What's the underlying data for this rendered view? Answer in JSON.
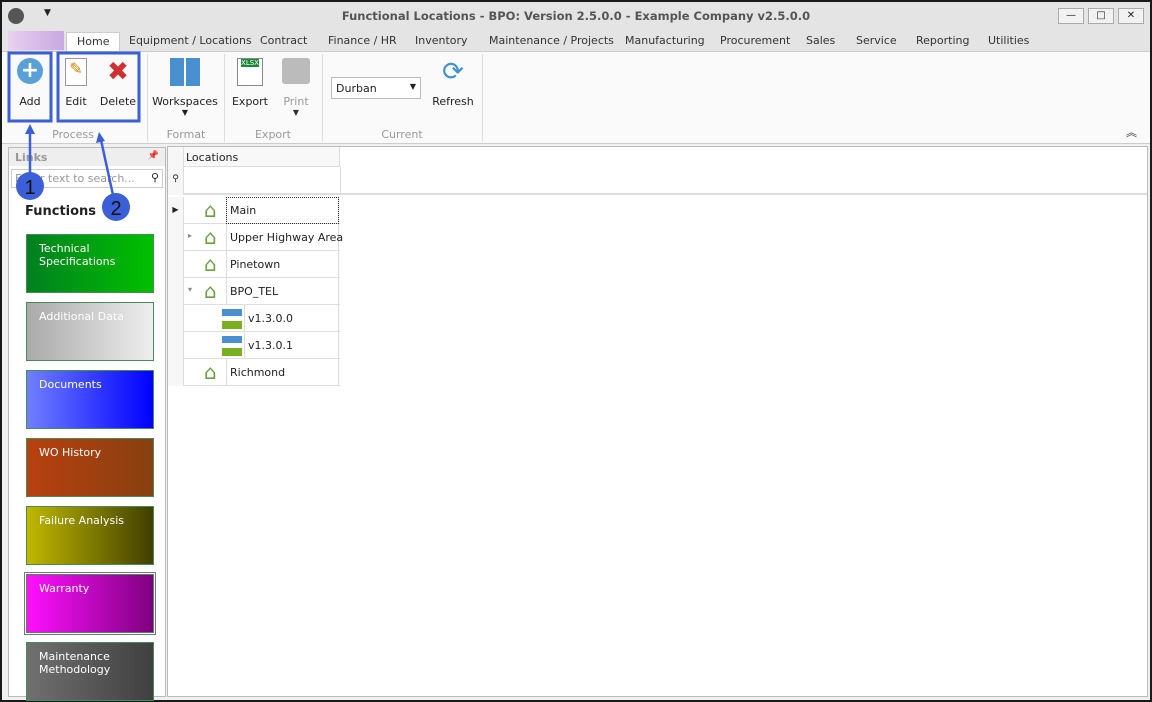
{
  "window": {
    "title": "Functional Locations - BPO: Version 2.5.0.0 - Example Company v2.5.0.0"
  },
  "tabs": [
    "Home",
    "Equipment / Locations",
    "Contract",
    "Finance / HR",
    "Inventory",
    "Maintenance / Projects",
    "Manufacturing",
    "Procurement",
    "Sales",
    "Service",
    "Reporting",
    "Utilities"
  ],
  "ribbon": {
    "add": "Add",
    "edit": "Edit",
    "delete": "Delete",
    "workspaces": "Workspaces",
    "export": "Export",
    "print": "Print",
    "refresh": "Refresh",
    "site": "Durban",
    "groups": {
      "process": "Process",
      "format": "Format",
      "export": "Export",
      "current": "Current"
    }
  },
  "links": {
    "title": "Links",
    "search_placeholder": "Enter text to search...",
    "functions": "Functions",
    "tiles": [
      "Technical Specifications",
      "Additional Data",
      "Documents",
      "WO History",
      "Failure Analysis",
      "Warranty",
      "Maintenance Methodology"
    ]
  },
  "grid": {
    "header": "Locations",
    "rows": [
      "Main",
      "Upper Highway Area",
      "Pinetown",
      "BPO_TEL",
      "v1.3.0.0",
      "v1.3.0.1",
      "Richmond"
    ]
  },
  "annotations": [
    "1",
    "2"
  ],
  "colors": {
    "annotation": "#3a5fd6"
  }
}
